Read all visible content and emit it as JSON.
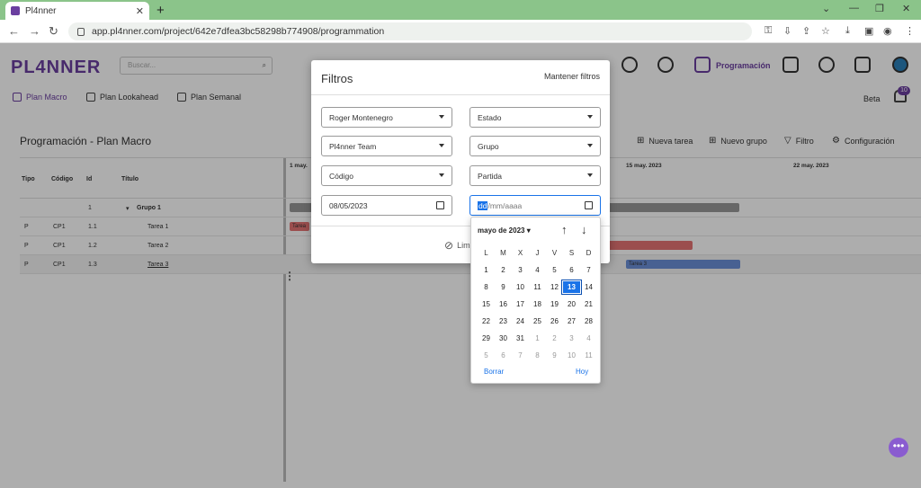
{
  "browser": {
    "tab_title": "Pl4nner",
    "url": "app.pl4nner.com/project/642e7dfea3bc58298b774908/programmation"
  },
  "app": {
    "logo": "PL4NNER",
    "search_placeholder": "Buscar...",
    "active_nav": "Programación",
    "beta": "Beta",
    "notif_count": "10",
    "subnav": [
      "Plan Macro",
      "Plan Lookahead",
      "Plan Semanal"
    ],
    "page_title": "Programación - Plan Macro",
    "tools": [
      "Nueva tarea",
      "Nuevo grupo",
      "Filtro",
      "Configuración"
    ]
  },
  "gantt": {
    "columns": [
      "Tipo",
      "Código",
      "Id",
      "Título"
    ],
    "weeks": [
      "1 may.",
      "15 may. 2023",
      "22 may. 2023"
    ],
    "rows": [
      {
        "tipo": "",
        "codigo": "",
        "id": "1",
        "titulo": "Grupo 1"
      },
      {
        "tipo": "P",
        "codigo": "CP1",
        "id": "1.1",
        "titulo": "Tarea 1"
      },
      {
        "tipo": "P",
        "codigo": "CP1",
        "id": "1.2",
        "titulo": "Tarea 2"
      },
      {
        "tipo": "P",
        "codigo": "CP1",
        "id": "1.3",
        "titulo": "Tarea 3"
      }
    ],
    "bar_labels": [
      "Tarea",
      "Tarea 3"
    ]
  },
  "filters": {
    "title": "Filtros",
    "keep": "Mantener filtros",
    "selects": [
      "Roger Montenegro",
      "Estado",
      "Pl4nner Team",
      "Grupo",
      "Código",
      "Partida"
    ],
    "date_from": "08/05/2023",
    "date_to_dd": "dd",
    "date_to_rest": "/mm/aaaa",
    "clear": "Lim"
  },
  "datepicker": {
    "month": "mayo de 2023",
    "weekdays": [
      "L",
      "M",
      "X",
      "J",
      "V",
      "S",
      "D"
    ],
    "days": [
      [
        "1",
        ""
      ],
      [
        "2",
        ""
      ],
      [
        "3",
        ""
      ],
      [
        "4",
        ""
      ],
      [
        "5",
        ""
      ],
      [
        "6",
        ""
      ],
      [
        "7",
        ""
      ],
      [
        "8",
        ""
      ],
      [
        "9",
        ""
      ],
      [
        "10",
        ""
      ],
      [
        "11",
        ""
      ],
      [
        "12",
        ""
      ],
      [
        "13",
        "sel"
      ],
      [
        "14",
        ""
      ],
      [
        "15",
        ""
      ],
      [
        "16",
        ""
      ],
      [
        "17",
        ""
      ],
      [
        "18",
        ""
      ],
      [
        "19",
        ""
      ],
      [
        "20",
        ""
      ],
      [
        "21",
        ""
      ],
      [
        "22",
        ""
      ],
      [
        "23",
        ""
      ],
      [
        "24",
        ""
      ],
      [
        "25",
        ""
      ],
      [
        "26",
        ""
      ],
      [
        "27",
        ""
      ],
      [
        "28",
        ""
      ],
      [
        "29",
        ""
      ],
      [
        "30",
        ""
      ],
      [
        "31",
        ""
      ],
      [
        "1",
        "o"
      ],
      [
        "2",
        "o"
      ],
      [
        "3",
        "o"
      ],
      [
        "4",
        "o"
      ],
      [
        "5",
        "o"
      ],
      [
        "6",
        "o"
      ],
      [
        "7",
        "o"
      ],
      [
        "8",
        "o"
      ],
      [
        "9",
        "o"
      ],
      [
        "10",
        "o"
      ],
      [
        "11",
        "o"
      ]
    ],
    "clear": "Borrar",
    "today": "Hoy"
  },
  "colors": {
    "accent": "#6b3fa0",
    "selected": "#1a73e8"
  }
}
